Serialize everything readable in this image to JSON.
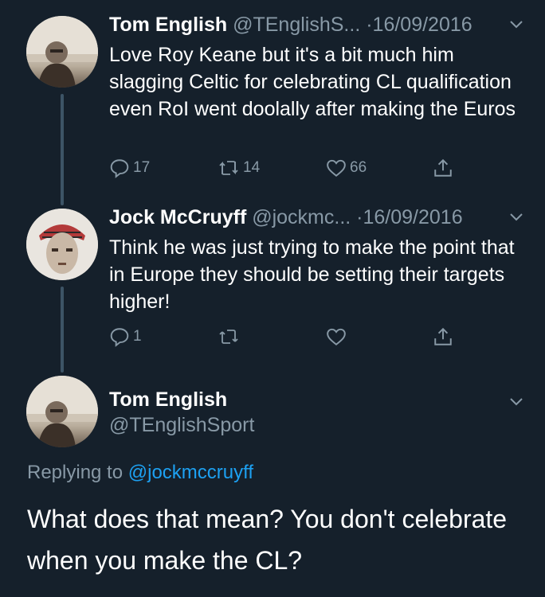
{
  "tweets": [
    {
      "name": "Tom English",
      "handle": "@TEnglishS...",
      "date": "·16/09/2016",
      "text": "Love Roy Keane but it's a bit much him slagging Celtic for celebrating CL qualification even RoI went doolally after making the Euros",
      "replies": "17",
      "retweets": "14",
      "likes": "66"
    },
    {
      "name": "Jock McCruyff",
      "handle": "@jockmc...",
      "date": "·16/09/2016",
      "text": "Think he was just trying to make the point that  in Europe they should be setting their targets higher!",
      "replies": "1",
      "retweets": "",
      "likes": ""
    }
  ],
  "main_tweet": {
    "name": "Tom English",
    "handle": "@TEnglishSport",
    "replying_prefix": "Replying to",
    "replying_to": "@jockmccruyff",
    "text": "What does that mean? You don't celebrate when you make the CL?"
  },
  "colors": {
    "background": "#15202b",
    "secondary_text": "#8899a6",
    "link": "#1da1f2",
    "thread_line": "#3d5466"
  },
  "icons": [
    "reply-icon",
    "retweet-icon",
    "like-icon",
    "share-icon",
    "chevron-down-icon"
  ]
}
